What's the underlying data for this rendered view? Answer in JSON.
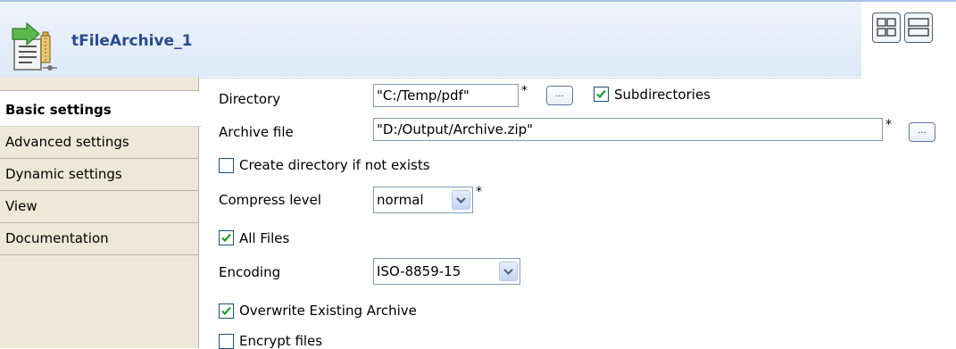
{
  "component": {
    "title": "tFileArchive_1",
    "icon": "file-archive-icon"
  },
  "header": {
    "layout_buttons": [
      "grid-layout-icon",
      "rows-layout-icon"
    ]
  },
  "sidebar": {
    "items": [
      {
        "label": "Basic settings",
        "active": true
      },
      {
        "label": "Advanced settings",
        "active": false
      },
      {
        "label": "Dynamic settings",
        "active": false
      },
      {
        "label": "View",
        "active": false
      },
      {
        "label": "Documentation",
        "active": false
      }
    ]
  },
  "form": {
    "directory": {
      "label": "Directory",
      "value": "\"C:/Temp/pdf\"",
      "required": "*",
      "browse": "..."
    },
    "subdirectories": {
      "label": "Subdirectories",
      "checked": true
    },
    "archive_file": {
      "label": "Archive file",
      "value": "\"D:/Output/Archive.zip\"",
      "required": "*",
      "browse": "..."
    },
    "create_directory": {
      "label": "Create directory if not exists",
      "checked": false
    },
    "compress_level": {
      "label": "Compress level",
      "value": "normal",
      "required": "*"
    },
    "all_files": {
      "label": "All Files",
      "checked": true
    },
    "encoding": {
      "label": "Encoding",
      "value": "ISO-8859-15"
    },
    "overwrite": {
      "label": "Overwrite Existing Archive",
      "checked": true
    },
    "encrypt": {
      "label": "Encrypt files",
      "checked": false
    }
  },
  "colors": {
    "title": "#2a4b8d",
    "header_bg": "#dde9f8",
    "sidebar_bg": "#ece9d8",
    "checkmark": "#21a121"
  }
}
